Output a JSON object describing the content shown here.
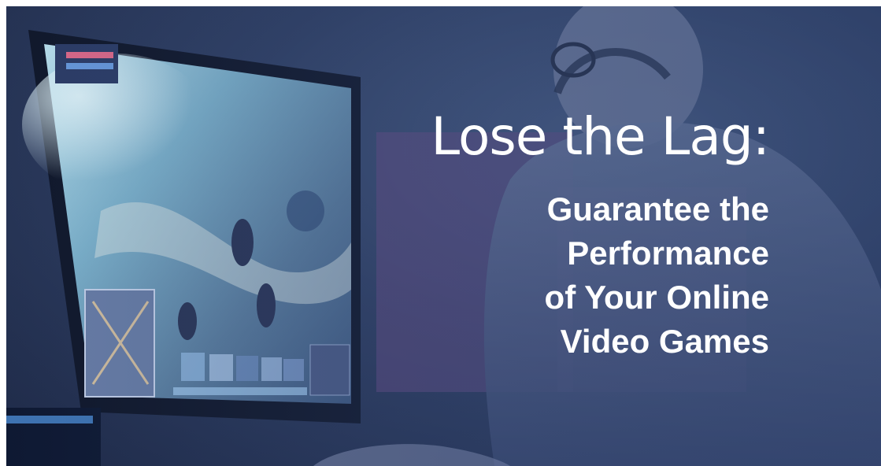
{
  "banner": {
    "title": "Lose the Lag:",
    "subtitle_lines": [
      "Guarantee the",
      "Performance",
      "of Your Online",
      "Video Games"
    ]
  },
  "colors": {
    "text": "#ffffff",
    "tint": "#3a4e78",
    "screen_glow": "#7fb0d8"
  }
}
